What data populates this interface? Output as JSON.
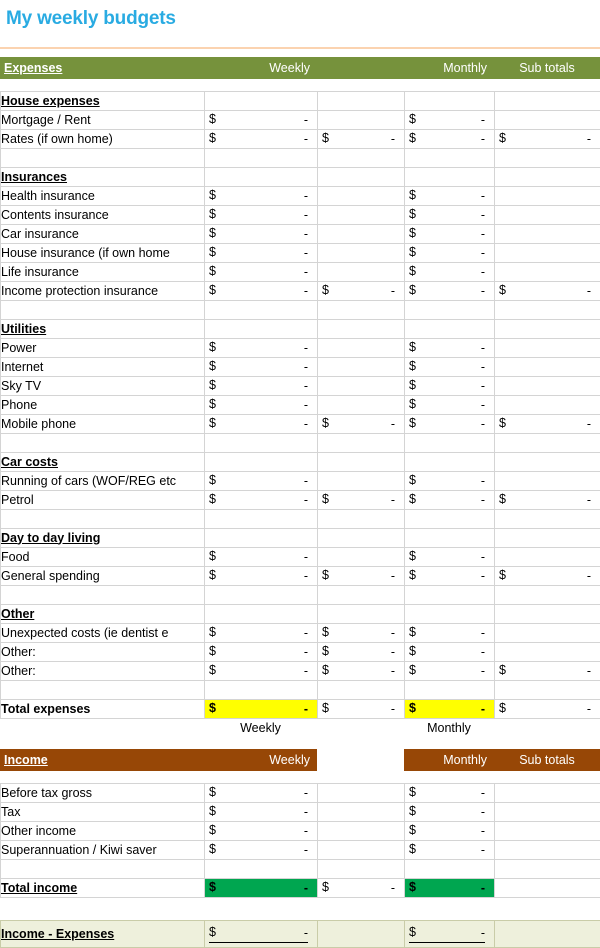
{
  "document": {
    "title": "My weekly budgets",
    "title_color": "#29ABE2",
    "rule_color": "#FBD3B0"
  },
  "colors": {
    "expenses_header_bg": "#76923C",
    "income_header_bg": "#974706",
    "total_expenses_highlight": "#FFFF00",
    "total_income_highlight": "#00A650",
    "net_row_bg": "#EEF0DC",
    "grid_line": "#D4D4D4"
  },
  "expenses_header": {
    "label": "Expenses",
    "weekly": "Weekly",
    "monthly": "Monthly",
    "sub_totals": "Sub totals"
  },
  "income_header": {
    "label": "Income",
    "weekly": "Weekly",
    "monthly": "Monthly",
    "sub_totals": "Sub totals"
  },
  "currency": "$",
  "blank_value": "-",
  "expense_sections": [
    {
      "name": "House expenses",
      "rows": [
        {
          "label": "Mortgage / Rent",
          "weekly": "-",
          "weekly_sub": "",
          "monthly": "-",
          "monthly_sub": ""
        },
        {
          "label": "Rates (if own home)",
          "weekly": "-",
          "weekly_sub": "-",
          "monthly": "-",
          "monthly_sub": "-"
        }
      ]
    },
    {
      "name": "Insurances",
      "rows": [
        {
          "label": "Health insurance",
          "weekly": "-",
          "weekly_sub": "",
          "monthly": "-",
          "monthly_sub": ""
        },
        {
          "label": "Contents insurance",
          "weekly": "-",
          "weekly_sub": "",
          "monthly": "-",
          "monthly_sub": ""
        },
        {
          "label": "Car insurance",
          "weekly": "-",
          "weekly_sub": "",
          "monthly": "-",
          "monthly_sub": ""
        },
        {
          "label": "House insurance (if own home",
          "weekly": "-",
          "weekly_sub": "",
          "monthly": "-",
          "monthly_sub": ""
        },
        {
          "label": "Life insurance",
          "weekly": "-",
          "weekly_sub": "",
          "monthly": "-",
          "monthly_sub": ""
        },
        {
          "label": "Income protection insurance",
          "weekly": "-",
          "weekly_sub": "-",
          "monthly": "-",
          "monthly_sub": "-"
        }
      ]
    },
    {
      "name": "Utilities",
      "rows": [
        {
          "label": "Power",
          "weekly": "-",
          "weekly_sub": "",
          "monthly": "-",
          "monthly_sub": ""
        },
        {
          "label": "Internet",
          "weekly": "-",
          "weekly_sub": "",
          "monthly": "-",
          "monthly_sub": ""
        },
        {
          "label": "Sky TV",
          "weekly": "-",
          "weekly_sub": "",
          "monthly": "-",
          "monthly_sub": ""
        },
        {
          "label": "Phone",
          "weekly": "-",
          "weekly_sub": "",
          "monthly": "-",
          "monthly_sub": ""
        },
        {
          "label": "Mobile phone",
          "weekly": "-",
          "weekly_sub": "-",
          "monthly": "-",
          "monthly_sub": "-"
        }
      ]
    },
    {
      "name": "Car costs",
      "rows": [
        {
          "label": "Running of cars (WOF/REG etc",
          "weekly": "-",
          "weekly_sub": "",
          "monthly": "-",
          "monthly_sub": ""
        },
        {
          "label": "Petrol",
          "weekly": "-",
          "weekly_sub": "-",
          "monthly": "-",
          "monthly_sub": "-"
        }
      ]
    },
    {
      "name": "Day to day living",
      "rows": [
        {
          "label": "Food",
          "weekly": "-",
          "weekly_sub": "",
          "monthly": "-",
          "monthly_sub": ""
        },
        {
          "label": "General spending",
          "weekly": "-",
          "weekly_sub": "-",
          "monthly": "-",
          "monthly_sub": "-"
        }
      ]
    },
    {
      "name": "Other",
      "rows": [
        {
          "label": "Unexpected costs (ie dentist e",
          "weekly": "-",
          "weekly_sub": "-",
          "monthly": "-",
          "monthly_sub": ""
        },
        {
          "label": "Other:",
          "weekly": "-",
          "weekly_sub": "-",
          "monthly": "-",
          "monthly_sub": ""
        },
        {
          "label": "Other:",
          "weekly": "-",
          "weekly_sub": "-",
          "monthly": "-",
          "monthly_sub": "-"
        }
      ]
    }
  ],
  "total_expenses": {
    "label": "Total expenses",
    "weekly": "-",
    "weekly_sub": "-",
    "monthly": "-",
    "monthly_sub": "-",
    "weekly_caption": "Weekly",
    "monthly_caption": "Monthly"
  },
  "income_rows": [
    {
      "label": "Before tax gross",
      "weekly": "-",
      "monthly": "-"
    },
    {
      "label": "Tax",
      "weekly": "-",
      "monthly": "-"
    },
    {
      "label": "Other income",
      "weekly": "-",
      "monthly": "-"
    },
    {
      "label": "Superannuation / Kiwi saver",
      "weekly": "-",
      "monthly": "-"
    }
  ],
  "total_income": {
    "label": "Total income",
    "weekly": "-",
    "weekly_sub": "-",
    "monthly": "-"
  },
  "net": {
    "label": "Income - Expenses",
    "weekly": "-",
    "monthly": "-"
  }
}
